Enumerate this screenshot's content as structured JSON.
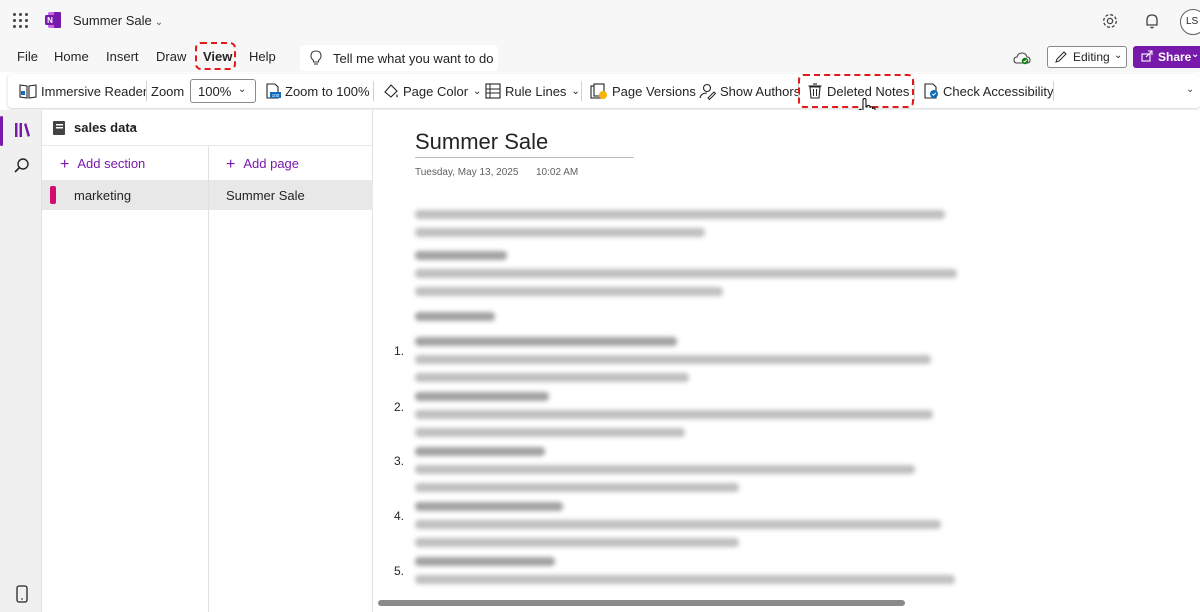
{
  "app": {
    "document_title": "Summer Sale",
    "avatar_initials": "LS",
    "brand_color": "#7719aa"
  },
  "ribbon_tabs": [
    {
      "label": "File"
    },
    {
      "label": "Home"
    },
    {
      "label": "Insert"
    },
    {
      "label": "Draw"
    },
    {
      "label": "View",
      "active": true
    },
    {
      "label": "Help"
    }
  ],
  "tell_me": {
    "placeholder": "Tell me what you want to do"
  },
  "mode": {
    "editing_label": "Editing",
    "share_label": "Share"
  },
  "toolbar": {
    "immersive_reader": "Immersive Reader",
    "zoom_label": "Zoom",
    "zoom_value": "100%",
    "zoom_to_100": "Zoom to 100%",
    "page_color": "Page Color",
    "rule_lines": "Rule Lines",
    "page_versions": "Page Versions",
    "show_authors": "Show Authors",
    "deleted_notes": "Deleted Notes",
    "check_accessibility": "Check Accessibility"
  },
  "notebook": {
    "name": "sales data",
    "add_section": "Add section",
    "add_page": "Add page",
    "sections": [
      {
        "name": "marketing",
        "color": "#d30c6e"
      }
    ],
    "pages": [
      {
        "name": "Summer Sale"
      }
    ]
  },
  "page": {
    "title": "Summer Sale",
    "date": "Tuesday, May 13, 2025",
    "time": "10:02 AM",
    "list_numbers": [
      "1.",
      "2.",
      "3.",
      "4.",
      "5."
    ]
  },
  "icons": [
    "waffle-icon",
    "onenote-logo-icon",
    "settings-icon",
    "bell-icon",
    "lightbulb-icon",
    "sync-icon",
    "pencil-icon",
    "share-icon",
    "immersive-reader-icon",
    "zoom-100-icon",
    "page-color-icon",
    "rule-lines-icon",
    "page-versions-icon",
    "show-authors-icon",
    "trash-icon",
    "accessibility-icon",
    "notebooks-icon",
    "search-icon",
    "mobile-icon",
    "notebook-icon"
  ]
}
